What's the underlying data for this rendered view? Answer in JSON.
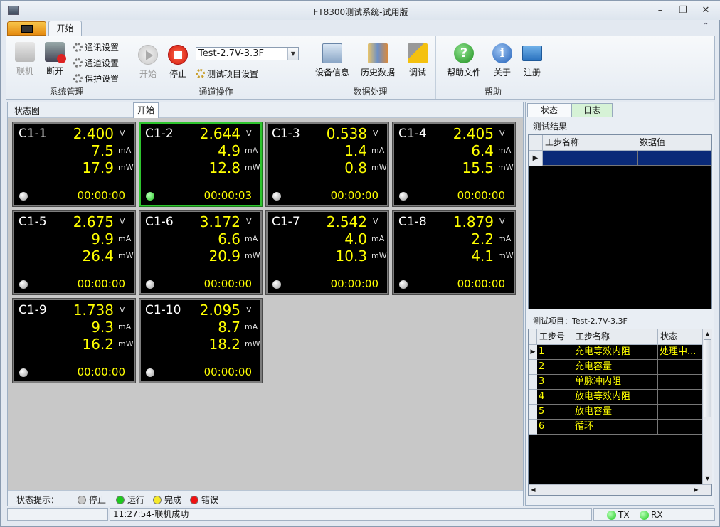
{
  "window": {
    "title": "FT8300测试系统-试用版"
  },
  "ribbon": {
    "tab_home": "开始",
    "groups": {
      "system": "系统管理",
      "channel": "通道操作",
      "data": "数据处理",
      "help": "帮助"
    },
    "connect": "联机",
    "disconnect": "断开",
    "comm_settings": "通讯设置",
    "channel_settings": "通道设置",
    "protect_settings": "保护设置",
    "start": "开始",
    "stop": "停止",
    "test_select": "Test-2.7V-3.3F",
    "test_item_settings": "测试项目设置",
    "device_info": "设备信息",
    "history_data": "历史数据",
    "debug": "调试",
    "help_file": "帮助文件",
    "about": "关于",
    "register": "注册"
  },
  "left": {
    "header": "状态图",
    "subtab": "开始",
    "units": {
      "v": "V",
      "ma": "mA",
      "mw": "mW"
    },
    "channels": [
      {
        "name": "C1-1",
        "v": "2.400",
        "ma": "7.5",
        "mw": "17.9",
        "time": "00:00:00",
        "state": "stop"
      },
      {
        "name": "C1-2",
        "v": "2.644",
        "ma": "4.9",
        "mw": "12.8",
        "time": "00:00:03",
        "state": "run"
      },
      {
        "name": "C1-3",
        "v": "0.538",
        "ma": "1.4",
        "mw": "0.8",
        "time": "00:00:00",
        "state": "stop"
      },
      {
        "name": "C1-4",
        "v": "2.405",
        "ma": "6.4",
        "mw": "15.5",
        "time": "00:00:00",
        "state": "stop"
      },
      {
        "name": "C1-5",
        "v": "2.675",
        "ma": "9.9",
        "mw": "26.4",
        "time": "00:00:00",
        "state": "stop"
      },
      {
        "name": "C1-6",
        "v": "3.172",
        "ma": "6.6",
        "mw": "20.9",
        "time": "00:00:00",
        "state": "stop"
      },
      {
        "name": "C1-7",
        "v": "2.542",
        "ma": "4.0",
        "mw": "10.3",
        "time": "00:00:00",
        "state": "stop"
      },
      {
        "name": "C1-8",
        "v": "1.879",
        "ma": "2.2",
        "mw": "4.1",
        "time": "00:00:00",
        "state": "stop"
      },
      {
        "name": "C1-9",
        "v": "1.738",
        "ma": "9.3",
        "mw": "16.2",
        "time": "00:00:00",
        "state": "stop"
      },
      {
        "name": "C1-10",
        "v": "2.095",
        "ma": "8.7",
        "mw": "18.2",
        "time": "00:00:00",
        "state": "stop"
      }
    ],
    "legend": {
      "title": "状态提示：",
      "stop": "停止",
      "run": "运行",
      "done": "完成",
      "error": "错误"
    }
  },
  "right": {
    "tab_status": "状态",
    "tab_log": "日志",
    "result_title": "测试结果",
    "result_cols": [
      "工步名称",
      "数据值"
    ],
    "project_label": "测试项目：",
    "project_name": "Test-2.7V-3.3F",
    "step_cols": [
      "工步号",
      "工步名称",
      "状态"
    ],
    "steps": [
      {
        "no": "1",
        "name": "充电等效内阻",
        "status": "处理中..."
      },
      {
        "no": "2",
        "name": "充电容量",
        "status": ""
      },
      {
        "no": "3",
        "name": "单脉冲内阻",
        "status": ""
      },
      {
        "no": "4",
        "name": "放电等效内阻",
        "status": ""
      },
      {
        "no": "5",
        "name": "放电容量",
        "status": ""
      },
      {
        "no": "6",
        "name": "循环",
        "status": ""
      }
    ]
  },
  "status": {
    "message": "11:27:54-联机成功",
    "tx": "TX",
    "rx": "RX"
  },
  "colors": {
    "value": "#ffff00",
    "selected_border": "#2ec52e",
    "run": "#1ec91e"
  }
}
